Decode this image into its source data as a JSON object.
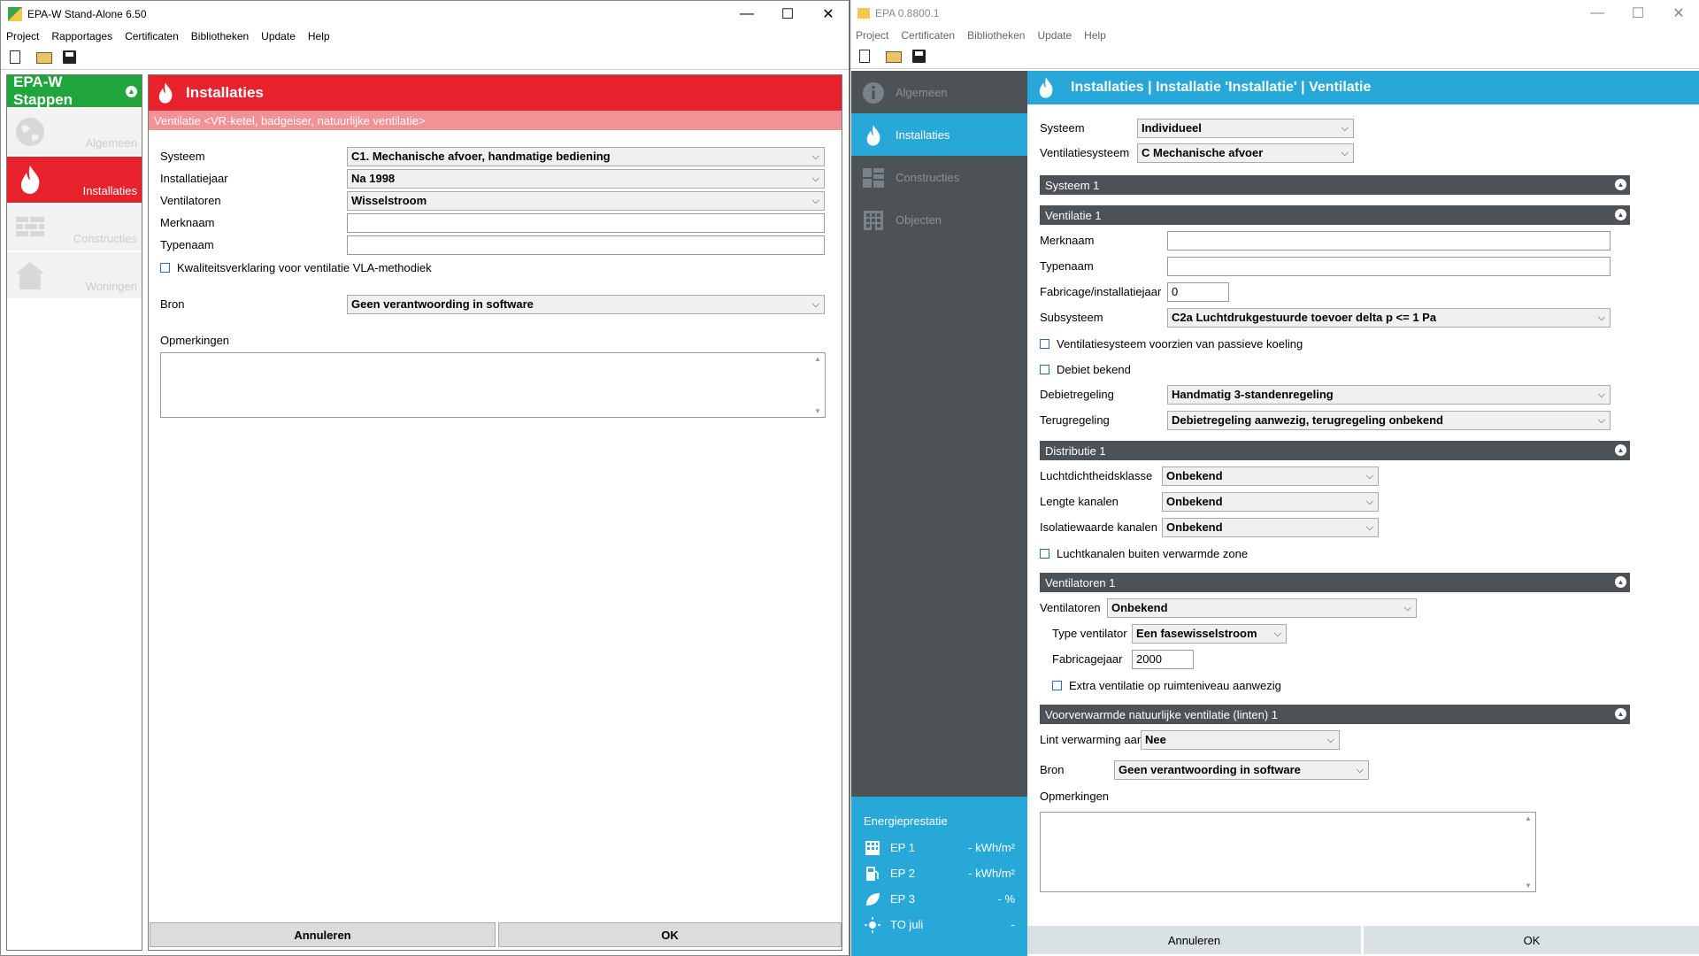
{
  "win1": {
    "title": "EPA-W Stand-Alone 6.50",
    "menu": [
      "Project",
      "Rapportages",
      "Certificaten",
      "Bibliotheken",
      "Update",
      "Help"
    ],
    "sidebar": {
      "title": "EPA-W Stappen",
      "steps": [
        "Algemeen",
        "Installaties",
        "Constructies",
        "Woningen"
      ]
    },
    "header": "Installaties",
    "subheader": "Ventilatie <VR-ketel, badgeiser, natuurlijke ventilatie>",
    "fields": {
      "systeem_label": "Systeem",
      "systeem_value": "C1. Mechanische afvoer, handmatige bediening",
      "installatiejaar_label": "Installatiejaar",
      "installatiejaar_value": "Na 1998",
      "ventilatoren_label": "Ventilatoren",
      "ventilatoren_value": "Wisselstroom",
      "merknaam_label": "Merknaam",
      "merknaam_value": "",
      "typenaam_label": "Typenaam",
      "typenaam_value": "",
      "kwaliteit_label": "Kwaliteitsverklaring voor ventilatie VLA-methodiek",
      "bron_label": "Bron",
      "bron_value": "Geen verantwoording in software",
      "opmerkingen_label": "Opmerkingen"
    },
    "buttons": {
      "cancel": "Annuleren",
      "ok": "OK"
    }
  },
  "win2": {
    "title": "EPA 0.8800.1",
    "menu": [
      "Project",
      "Certificaten",
      "Bibliotheken",
      "Update",
      "Help"
    ],
    "sidebar": [
      "Algemeen",
      "Installaties",
      "Constructies",
      "Objecten"
    ],
    "energy": {
      "title": "Energieprestatie",
      "rows": [
        {
          "name": "EP 1",
          "value": "- kWh/m²"
        },
        {
          "name": "EP 2",
          "value": "- kWh/m²"
        },
        {
          "name": "EP 3",
          "value": "- %"
        },
        {
          "name": "TO juli",
          "value": "-"
        }
      ]
    },
    "header": "Installaties | Installatie 'Installatie' | Ventilatie",
    "systeem_label": "Systeem",
    "systeem_value": "Individueel",
    "ventsys_label": "Ventilatiesysteem",
    "ventsys_value": "C Mechanische afvoer",
    "sect_systeem": "Systeem 1",
    "sect_ventilatie": "Ventilatie 1",
    "merknaam_label": "Merknaam",
    "typenaam_label": "Typenaam",
    "fabricage_label": "Fabricage/installatiejaar",
    "fabricage_value": "0",
    "subsysteem_label": "Subsysteem",
    "subsysteem_value": "C2a Luchtdrukgestuurde toevoer delta p <= 1 Pa",
    "passief_label": "Ventilatiesysteem voorzien van passieve koeling",
    "debiet_label": "Debiet bekend",
    "debietregeling_label": "Debietregeling",
    "debietregeling_value": "Handmatig 3-standenregeling",
    "terugregeling_label": "Terugregeling",
    "terugregeling_value": "Debietregeling aanwezig, terugregeling onbekend",
    "sect_distributie": "Distributie 1",
    "lucht_label": "Luchtdichtheidsklasse",
    "lucht_value": "Onbekend",
    "lengte_label": "Lengte kanalen",
    "lengte_value": "Onbekend",
    "isolatie_label": "Isolatiewaarde kanalen",
    "isolatie_value": "Onbekend",
    "buiten_label": "Luchtkanalen buiten verwarmde zone",
    "sect_ventilatoren": "Ventilatoren 1",
    "ventilatoren_label": "Ventilatoren",
    "ventilatoren_value": "Onbekend",
    "type_label": "Type ventilator",
    "type_value": "Een fasewisselstroom",
    "fabjaar_label": "Fabricagejaar",
    "fabjaar_value": "2000",
    "extra_label": "Extra ventilatie op ruimteniveau aanwezig",
    "sect_voorverwarmd": "Voorverwarmde natuurlijke ventilatie (linten) 1",
    "lint_label": "Lint verwarming aanwezig",
    "lint_value": "Nee",
    "bron_label": "Bron",
    "bron_value": "Geen verantwoording in software",
    "opmerkingen_label": "Opmerkingen",
    "buttons": {
      "cancel": "Annuleren",
      "ok": "OK"
    }
  }
}
